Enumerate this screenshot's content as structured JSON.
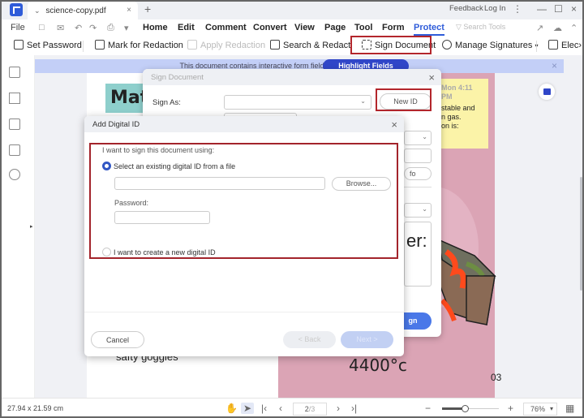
{
  "titlebar": {
    "tab_title": "science-copy.pdf",
    "new_tab": "+",
    "feedback": "Feedback",
    "login": "Log In"
  },
  "menu": {
    "file": "File",
    "items": [
      "Home",
      "Edit",
      "Comment",
      "Convert",
      "View",
      "Page",
      "Tool",
      "Form",
      "Protect"
    ],
    "active": "Protect",
    "search_tools": "Search Tools"
  },
  "toolbar": {
    "set_password": "Set Password",
    "mark_redaction": "Mark for Redaction",
    "apply_redaction": "Apply Redaction",
    "search_redact": "Search & Redact",
    "sign_document": "Sign Document",
    "manage_signatures": "Manage Signatures",
    "elec": "Elec"
  },
  "banner": {
    "text": "This document contains interactive form fields.",
    "highlight_button": "Highlight Fields"
  },
  "page": {
    "title_fragment": "Mat",
    "note_time": "Mon 4:11 PM",
    "note_lines": [
      "stable and",
      "n gas.",
      "on is:"
    ],
    "big_text": "er:",
    "goggles": "safty goggles",
    "temperature": "4400°c",
    "page_number": "03"
  },
  "sign_dialog": {
    "title": "Sign Document",
    "sign_as_label": "Sign As:",
    "new_id_button": "New ID",
    "info_button": "fo",
    "sign_button": "gn"
  },
  "add_id_dialog": {
    "title": "Add Digital ID",
    "prompt": "I want to sign this document using:",
    "option_existing": "Select an existing digital ID from a file",
    "option_new": "I want to create a new digital ID",
    "browse_button": "Browse...",
    "password_label": "Password:",
    "file_value": "",
    "password_value": "",
    "selected_option": "existing",
    "cancel_button": "Cancel",
    "back_button": "< Back",
    "next_button": "Next >"
  },
  "statusbar": {
    "dimensions": "27.94 x 21.59 cm",
    "page_current": "2",
    "page_total": "/3",
    "zoom": "76%",
    "zoom_fraction": 0.4
  },
  "colors": {
    "accent": "#2f5cd9",
    "highlight_red": "#a3242b",
    "banner": "#c3cff7"
  }
}
